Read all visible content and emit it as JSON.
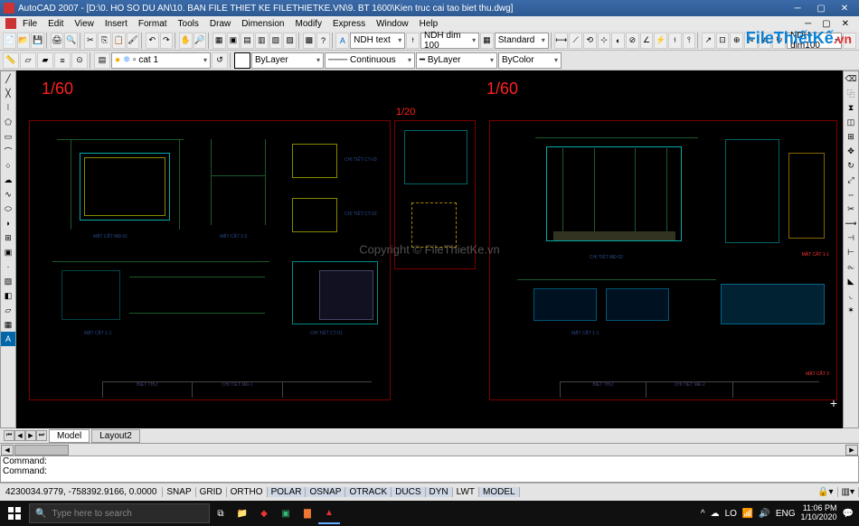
{
  "app": {
    "title": "AutoCAD 2007 - [D:\\0. HO SO DU AN\\10. BAN FILE THIET KE FILETHIETKE.VN\\9. BT 1600\\Kien truc cai tao biet thu.dwg]",
    "watermark_center": "Copyright © FileThietKe.vn",
    "logo_file": "File",
    "logo_tk": "ThiếtKế",
    "logo_vn": ".vn"
  },
  "menu": [
    "File",
    "Edit",
    "View",
    "Insert",
    "Format",
    "Tools",
    "Draw",
    "Dimension",
    "Modify",
    "Express",
    "Window",
    "Help"
  ],
  "toolbar1": {
    "layer_combo": "cat 1",
    "dim_style1": "NDH text",
    "dim_style2": "NDH dim 100",
    "text_style": "Standard",
    "dim_style3": "NDH dim100"
  },
  "toolbar2": {
    "layer_sel": "ByLayer",
    "linetype": "Continuous",
    "lineweight": "ByLayer",
    "color": "ByColor"
  },
  "canvas": {
    "scale_left": "1/60",
    "scale_mid": "1/20",
    "scale_right": "1/60",
    "sheet1_title": "BIỆT THỰ",
    "sheet1_detail": "CHI TIẾT MĐ-1",
    "sheet2_title": "BIỆT THỰ",
    "sheet2_detail": "CHI TIẾT MĐ-2",
    "labels": {
      "mc01": "MẶT CẮT MĐ-01",
      "mc11": "MẶT CẮT 1-1",
      "mc22": "MẶT CẮT 2-2",
      "ct01": "CHI TIẾT CT-01",
      "ct02": "CHI TIẾT CT-02",
      "ct03": "CHI TIẾT CT-03",
      "md02": "CHI TIẾT MĐ-02"
    }
  },
  "tabs": {
    "model": "Model",
    "layout": "Layout2"
  },
  "command": {
    "line1": "Command:",
    "line2": "Command:"
  },
  "status": {
    "coords": "4230034.9779, -758392.9166, 0.0000",
    "toggles": [
      "SNAP",
      "GRID",
      "ORTHO",
      "POLAR",
      "OSNAP",
      "OTRACK",
      "DUCS",
      "DYN",
      "LWT",
      "MODEL"
    ]
  },
  "taskbar": {
    "search_placeholder": "Type here to search",
    "tray": {
      "lang1": "LO",
      "lang2": "ENG",
      "time": "11:06 PM",
      "date": "1/10/2020"
    }
  }
}
